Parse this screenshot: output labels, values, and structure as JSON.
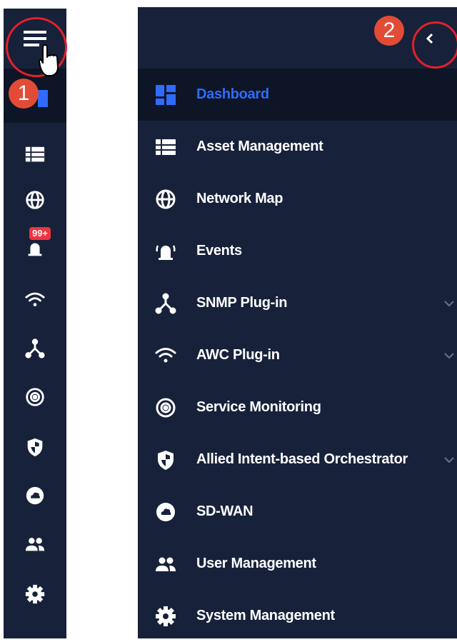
{
  "colors": {
    "sidebar_bg": "#17213a",
    "active_bg": "#0e1526",
    "active_text": "#2f6bff",
    "text": "#ffffff",
    "annotation_red": "#e2202a",
    "badge_red": "#ef3340"
  },
  "mini_sidebar": {
    "hamburger_icon": "hamburger-menu-icon",
    "events_badge": "99+",
    "icons": [
      "dashboard-icon",
      "list-icon",
      "globe-icon",
      "alarm-bell-icon",
      "wifi-icon",
      "network-node-icon",
      "radar-icon",
      "shield-icon",
      "cloud-icon",
      "users-icon",
      "gear-icon"
    ]
  },
  "annotations": {
    "step1": "1",
    "step2": "2"
  },
  "full_sidebar": {
    "collapse_icon": "chevron-left-icon",
    "items": [
      {
        "label": "Dashboard",
        "icon": "dashboard-icon",
        "active": true,
        "expandable": false
      },
      {
        "label": "Asset Management",
        "icon": "list-icon",
        "active": false,
        "expandable": false
      },
      {
        "label": "Network Map",
        "icon": "globe-icon",
        "active": false,
        "expandable": false
      },
      {
        "label": "Events",
        "icon": "alarm-bell-icon",
        "active": false,
        "expandable": false
      },
      {
        "label": "SNMP Plug-in",
        "icon": "network-node-icon",
        "active": false,
        "expandable": true
      },
      {
        "label": "AWC Plug-in",
        "icon": "wifi-icon",
        "active": false,
        "expandable": true
      },
      {
        "label": "Service Monitoring",
        "icon": "radar-icon",
        "active": false,
        "expandable": false
      },
      {
        "label": "Allied Intent-based Orchestrator",
        "icon": "shield-icon",
        "active": false,
        "expandable": true
      },
      {
        "label": "SD-WAN",
        "icon": "cloud-icon",
        "active": false,
        "expandable": false
      },
      {
        "label": "User Management",
        "icon": "users-icon",
        "active": false,
        "expandable": false
      },
      {
        "label": "System Management",
        "icon": "gear-icon",
        "active": false,
        "expandable": false
      }
    ]
  }
}
